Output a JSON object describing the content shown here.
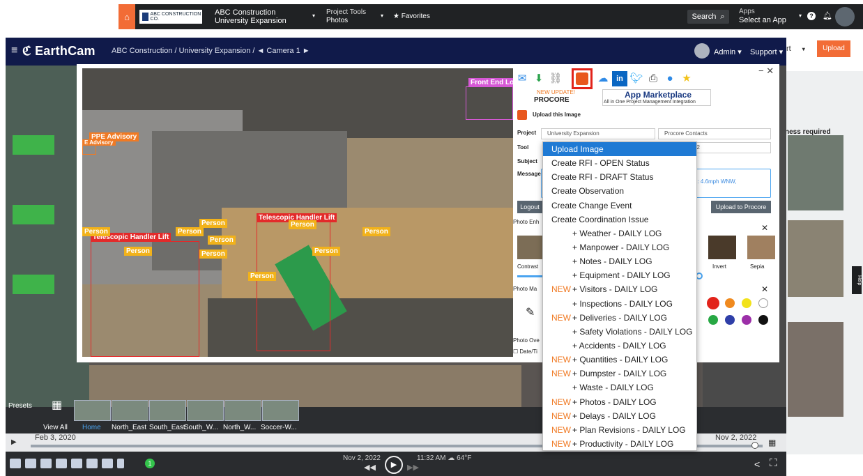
{
  "procore_header": {
    "company_logo": "ABC CONSTRUCTION CO.",
    "project_line1": "ABC Construction",
    "project_line2": "University Expansion",
    "tool_label": "Project Tools",
    "tool_value": "Photos",
    "favorites": "Favorites",
    "search": "Search",
    "apps_label": "Apps",
    "apps_value": "Select an App"
  },
  "procore_right": {
    "dropdown_label": "rt",
    "upload": "Upload",
    "notice": "ness required",
    "help": "Help"
  },
  "earthcam": {
    "brand": "EarthCam",
    "breadcrumb": "ABC Construction / University Expansion /  ◄  Camera 1  ►",
    "admin": "Admin ▾",
    "support": "Support ▾"
  },
  "presets": {
    "label": "Presets",
    "view_all": "View All",
    "items": [
      "Home",
      "North_East",
      "South_East",
      "South_W...",
      "North_W...",
      "Soccer-W..."
    ]
  },
  "timeline": {
    "start": "Feb 3, 2020",
    "end": "Nov 2, 2022"
  },
  "player": {
    "date": "Nov 2, 2022",
    "time": "11:32 AM ☁ 64°F",
    "badge": "1"
  },
  "detections": [
    {
      "label": "Front End Lo"
    },
    {
      "label": "PPE Advisory"
    },
    {
      "label": "E Advisory"
    },
    {
      "label": "Telescopic Handler Lift"
    },
    {
      "label": "Telescopic Handler Lift"
    },
    {
      "label": "Person"
    },
    {
      "label": "Person"
    },
    {
      "label": "Person"
    },
    {
      "label": "Person"
    },
    {
      "label": "Person"
    },
    {
      "label": "Person"
    },
    {
      "label": "Person"
    },
    {
      "label": "Person"
    },
    {
      "label": "Person"
    },
    {
      "label": "Person"
    }
  ],
  "share": {
    "new_update": "NEW UPDATE!",
    "procore": "PROCORE",
    "marketplace": "App Marketplace",
    "marketplace_sub": "All in One Project Management Integration",
    "upload_this": "Upload this Image",
    "project_label": "Project",
    "project_value": "University Expansion",
    "contacts_value": "Procore Contacts",
    "tool_label": "Tool",
    "tool_date": "22",
    "subject_label": "Subject",
    "message_label": "Message",
    "message_text": "d: 4.6mph WNW,",
    "logout": "Logout",
    "upload_to_procore": "Upload to Procore",
    "photo_enh": "Photo Enh",
    "contrast": "Contrast",
    "invert": "Invert",
    "sepia": "Sepia",
    "photo_mark": "Photo Ma",
    "photo_overlay": "Photo Ove",
    "datetime": "Date/Ti"
  },
  "dropdown": {
    "items": [
      {
        "text": "Upload Image",
        "new": "",
        "selected": true,
        "sub": false
      },
      {
        "text": "Create RFI - OPEN Status",
        "new": "",
        "sub": false
      },
      {
        "text": "Create RFI - DRAFT Status",
        "new": "",
        "sub": false
      },
      {
        "text": "Create Observation",
        "new": "",
        "sub": false
      },
      {
        "text": "Create Change Event",
        "new": "",
        "sub": false
      },
      {
        "text": "Create Coordination Issue",
        "new": "",
        "sub": false
      },
      {
        "text": "+ Weather - DAILY LOG",
        "new": "",
        "sub": true
      },
      {
        "text": "+ Manpower - DAILY LOG",
        "new": "",
        "sub": true
      },
      {
        "text": "+ Notes - DAILY LOG",
        "new": "",
        "sub": true
      },
      {
        "text": "+ Equipment - DAILY LOG",
        "new": "",
        "sub": true
      },
      {
        "text": "+ Visitors - DAILY LOG",
        "new": "NEW",
        "sub": true
      },
      {
        "text": "+ Inspections - DAILY LOG",
        "new": "",
        "sub": true
      },
      {
        "text": "+ Deliveries - DAILY LOG",
        "new": "NEW",
        "sub": true
      },
      {
        "text": "+ Safety Violations - DAILY LOG",
        "new": "",
        "sub": true
      },
      {
        "text": "+ Accidents - DAILY LOG",
        "new": "",
        "sub": true
      },
      {
        "text": "+ Quantities - DAILY LOG",
        "new": "NEW",
        "sub": true
      },
      {
        "text": "+ Dumpster - DAILY LOG",
        "new": "NEW",
        "sub": true
      },
      {
        "text": "+ Waste - DAILY LOG",
        "new": "",
        "sub": true
      },
      {
        "text": "+ Photos - DAILY LOG",
        "new": "NEW",
        "sub": true
      },
      {
        "text": "+ Delays - DAILY LOG",
        "new": "NEW",
        "sub": true
      },
      {
        "text": "+ Plan Revisions - DAILY LOG",
        "new": "NEW",
        "sub": true
      },
      {
        "text": "+ Productivity - DAILY LOG",
        "new": "NEW",
        "sub": true
      }
    ]
  },
  "colors": {
    "accent": "#1f7ad4",
    "procore_orange": "#f26c36",
    "new_orange": "#f07a24",
    "earthcam_navy": "#101a4a",
    "palette": [
      "#e2231a",
      "#f08a1f",
      "#f2e21a",
      "#ffffff",
      "#27a844",
      "#2f3fa8",
      "#9c2fa8",
      "#111111"
    ]
  }
}
